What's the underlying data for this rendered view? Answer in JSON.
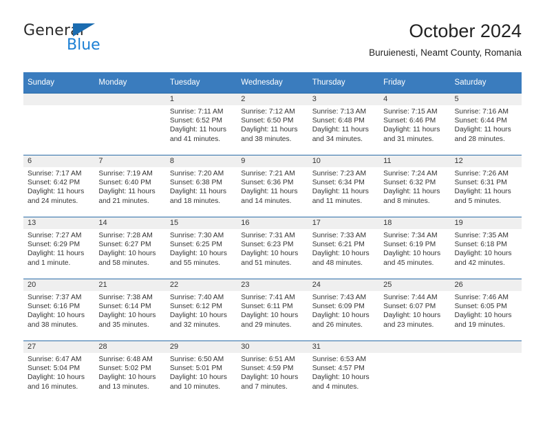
{
  "brand": {
    "name_top": "General",
    "name_bottom": "Blue",
    "triangle_color": "#1b6cb0",
    "blue_color": "#1b7fd4"
  },
  "header": {
    "title": "October 2024",
    "location": "Buruienesti, Neamt County, Romania"
  },
  "theme": {
    "header_bg": "#3a7cbe",
    "row_border": "#2a6ca8",
    "daynum_band_bg": "#efefef",
    "text": "#333333"
  },
  "weekdays": [
    "Sunday",
    "Monday",
    "Tuesday",
    "Wednesday",
    "Thursday",
    "Friday",
    "Saturday"
  ],
  "labels": {
    "sunrise_prefix": "Sunrise:",
    "sunset_prefix": "Sunset:",
    "daylight_prefix": "Daylight:"
  },
  "weeks": [
    [
      {
        "day": "",
        "l1": "",
        "l2": "",
        "l3": "",
        "l4": ""
      },
      {
        "day": "",
        "l1": "",
        "l2": "",
        "l3": "",
        "l4": ""
      },
      {
        "day": "1",
        "l1": "Sunrise: 7:11 AM",
        "l2": "Sunset: 6:52 PM",
        "l3": "Daylight: 11 hours",
        "l4": "and 41 minutes."
      },
      {
        "day": "2",
        "l1": "Sunrise: 7:12 AM",
        "l2": "Sunset: 6:50 PM",
        "l3": "Daylight: 11 hours",
        "l4": "and 38 minutes."
      },
      {
        "day": "3",
        "l1": "Sunrise: 7:13 AM",
        "l2": "Sunset: 6:48 PM",
        "l3": "Daylight: 11 hours",
        "l4": "and 34 minutes."
      },
      {
        "day": "4",
        "l1": "Sunrise: 7:15 AM",
        "l2": "Sunset: 6:46 PM",
        "l3": "Daylight: 11 hours",
        "l4": "and 31 minutes."
      },
      {
        "day": "5",
        "l1": "Sunrise: 7:16 AM",
        "l2": "Sunset: 6:44 PM",
        "l3": "Daylight: 11 hours",
        "l4": "and 28 minutes."
      }
    ],
    [
      {
        "day": "6",
        "l1": "Sunrise: 7:17 AM",
        "l2": "Sunset: 6:42 PM",
        "l3": "Daylight: 11 hours",
        "l4": "and 24 minutes."
      },
      {
        "day": "7",
        "l1": "Sunrise: 7:19 AM",
        "l2": "Sunset: 6:40 PM",
        "l3": "Daylight: 11 hours",
        "l4": "and 21 minutes."
      },
      {
        "day": "8",
        "l1": "Sunrise: 7:20 AM",
        "l2": "Sunset: 6:38 PM",
        "l3": "Daylight: 11 hours",
        "l4": "and 18 minutes."
      },
      {
        "day": "9",
        "l1": "Sunrise: 7:21 AM",
        "l2": "Sunset: 6:36 PM",
        "l3": "Daylight: 11 hours",
        "l4": "and 14 minutes."
      },
      {
        "day": "10",
        "l1": "Sunrise: 7:23 AM",
        "l2": "Sunset: 6:34 PM",
        "l3": "Daylight: 11 hours",
        "l4": "and 11 minutes."
      },
      {
        "day": "11",
        "l1": "Sunrise: 7:24 AM",
        "l2": "Sunset: 6:32 PM",
        "l3": "Daylight: 11 hours",
        "l4": "and 8 minutes."
      },
      {
        "day": "12",
        "l1": "Sunrise: 7:26 AM",
        "l2": "Sunset: 6:31 PM",
        "l3": "Daylight: 11 hours",
        "l4": "and 5 minutes."
      }
    ],
    [
      {
        "day": "13",
        "l1": "Sunrise: 7:27 AM",
        "l2": "Sunset: 6:29 PM",
        "l3": "Daylight: 11 hours",
        "l4": "and 1 minute."
      },
      {
        "day": "14",
        "l1": "Sunrise: 7:28 AM",
        "l2": "Sunset: 6:27 PM",
        "l3": "Daylight: 10 hours",
        "l4": "and 58 minutes."
      },
      {
        "day": "15",
        "l1": "Sunrise: 7:30 AM",
        "l2": "Sunset: 6:25 PM",
        "l3": "Daylight: 10 hours",
        "l4": "and 55 minutes."
      },
      {
        "day": "16",
        "l1": "Sunrise: 7:31 AM",
        "l2": "Sunset: 6:23 PM",
        "l3": "Daylight: 10 hours",
        "l4": "and 51 minutes."
      },
      {
        "day": "17",
        "l1": "Sunrise: 7:33 AM",
        "l2": "Sunset: 6:21 PM",
        "l3": "Daylight: 10 hours",
        "l4": "and 48 minutes."
      },
      {
        "day": "18",
        "l1": "Sunrise: 7:34 AM",
        "l2": "Sunset: 6:19 PM",
        "l3": "Daylight: 10 hours",
        "l4": "and 45 minutes."
      },
      {
        "day": "19",
        "l1": "Sunrise: 7:35 AM",
        "l2": "Sunset: 6:18 PM",
        "l3": "Daylight: 10 hours",
        "l4": "and 42 minutes."
      }
    ],
    [
      {
        "day": "20",
        "l1": "Sunrise: 7:37 AM",
        "l2": "Sunset: 6:16 PM",
        "l3": "Daylight: 10 hours",
        "l4": "and 38 minutes."
      },
      {
        "day": "21",
        "l1": "Sunrise: 7:38 AM",
        "l2": "Sunset: 6:14 PM",
        "l3": "Daylight: 10 hours",
        "l4": "and 35 minutes."
      },
      {
        "day": "22",
        "l1": "Sunrise: 7:40 AM",
        "l2": "Sunset: 6:12 PM",
        "l3": "Daylight: 10 hours",
        "l4": "and 32 minutes."
      },
      {
        "day": "23",
        "l1": "Sunrise: 7:41 AM",
        "l2": "Sunset: 6:11 PM",
        "l3": "Daylight: 10 hours",
        "l4": "and 29 minutes."
      },
      {
        "day": "24",
        "l1": "Sunrise: 7:43 AM",
        "l2": "Sunset: 6:09 PM",
        "l3": "Daylight: 10 hours",
        "l4": "and 26 minutes."
      },
      {
        "day": "25",
        "l1": "Sunrise: 7:44 AM",
        "l2": "Sunset: 6:07 PM",
        "l3": "Daylight: 10 hours",
        "l4": "and 23 minutes."
      },
      {
        "day": "26",
        "l1": "Sunrise: 7:46 AM",
        "l2": "Sunset: 6:05 PM",
        "l3": "Daylight: 10 hours",
        "l4": "and 19 minutes."
      }
    ],
    [
      {
        "day": "27",
        "l1": "Sunrise: 6:47 AM",
        "l2": "Sunset: 5:04 PM",
        "l3": "Daylight: 10 hours",
        "l4": "and 16 minutes."
      },
      {
        "day": "28",
        "l1": "Sunrise: 6:48 AM",
        "l2": "Sunset: 5:02 PM",
        "l3": "Daylight: 10 hours",
        "l4": "and 13 minutes."
      },
      {
        "day": "29",
        "l1": "Sunrise: 6:50 AM",
        "l2": "Sunset: 5:01 PM",
        "l3": "Daylight: 10 hours",
        "l4": "and 10 minutes."
      },
      {
        "day": "30",
        "l1": "Sunrise: 6:51 AM",
        "l2": "Sunset: 4:59 PM",
        "l3": "Daylight: 10 hours",
        "l4": "and 7 minutes."
      },
      {
        "day": "31",
        "l1": "Sunrise: 6:53 AM",
        "l2": "Sunset: 4:57 PM",
        "l3": "Daylight: 10 hours",
        "l4": "and 4 minutes."
      },
      {
        "day": "",
        "l1": "",
        "l2": "",
        "l3": "",
        "l4": ""
      },
      {
        "day": "",
        "l1": "",
        "l2": "",
        "l3": "",
        "l4": ""
      }
    ]
  ]
}
